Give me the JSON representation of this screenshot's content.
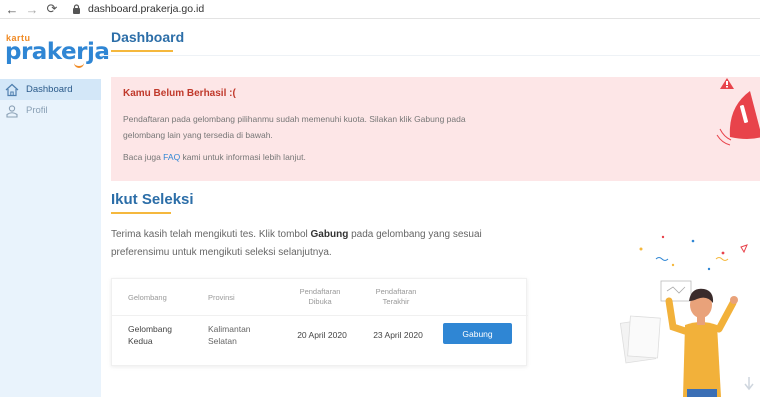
{
  "browser": {
    "url": "dashboard.prakerja.go.id",
    "icons": [
      "back-arrow-icon",
      "forward-arrow-icon",
      "reload-icon",
      "lock-icon"
    ]
  },
  "sidebar": {
    "logo_small": "kartu",
    "logo_main": "prakerja",
    "items": [
      {
        "label": "Dashboard",
        "icon": "home-icon",
        "active": true
      },
      {
        "label": "Profil",
        "icon": "profile-icon",
        "active": false
      }
    ]
  },
  "header": {
    "title": "Dashboard"
  },
  "alert": {
    "title": "Kamu Belum Berhasil :(",
    "body": "Pendaftaran pada gelombang pilihanmu sudah memenuhi kuota. Silakan klik Gabung pada gelombang lain yang tersedia di bawah.",
    "faq_prefix": "Baca juga ",
    "faq_link": "FAQ",
    "faq_suffix": " kami untuk informasi lebih lanjut."
  },
  "selection": {
    "title": "Ikut Seleksi",
    "desc_prefix": "Terima kasih telah mengikuti tes. Klik tombol ",
    "desc_bold": "Gabung",
    "desc_suffix": " pada gelombang yang sesuai preferensimu untuk mengikuti seleksi selanjutnya.",
    "table": {
      "headers": {
        "gelombang": "Gelombang",
        "provinsi": "Provinsi",
        "dibuka_1": "Pendaftaran",
        "dibuka_2": "Dibuka",
        "terakhir_1": "Pendaftaran",
        "terakhir_2": "Terakhir"
      },
      "row": {
        "gelombang_1": "Gelombang",
        "gelombang_2": "Kedua",
        "provinsi_1": "Kalimantan",
        "provinsi_2": "Selatan",
        "dibuka": "20 April 2020",
        "terakhir": "23 April 2020",
        "button": "Gabung"
      }
    }
  },
  "colors": {
    "accent": "#2f86d4",
    "title": "#2c6ea8",
    "underline": "#f5b83d",
    "alert_bg": "#fde6e7",
    "alert_title": "#c0392b",
    "sidebar_bg": "#e9f3fc",
    "logo_orange": "#f08a24"
  }
}
